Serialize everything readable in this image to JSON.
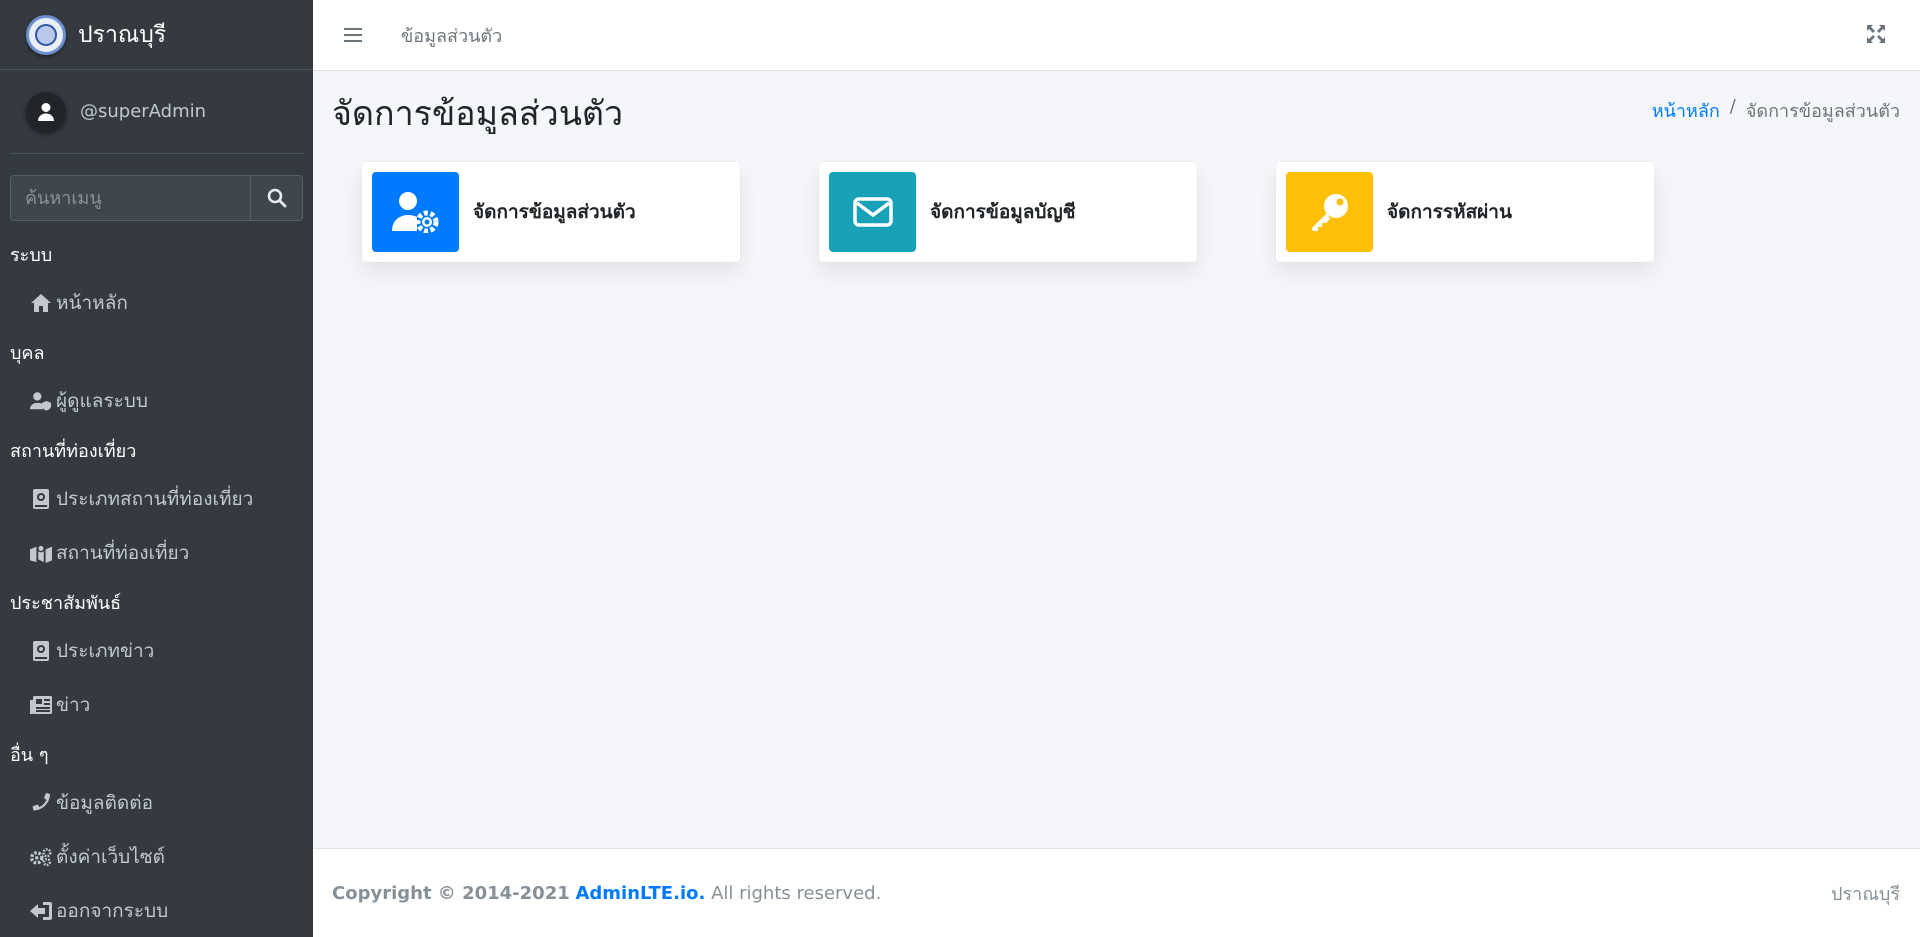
{
  "brand": {
    "name": "ปราณบุรี"
  },
  "user": {
    "name": "@superAdmin"
  },
  "sidebar": {
    "search_placeholder": "ค้นหาเมนู",
    "sections": [
      {
        "header": "ระบบ",
        "items": [
          {
            "label": "หน้าหลัก",
            "icon": "home-icon"
          }
        ]
      },
      {
        "header": "บุคล",
        "items": [
          {
            "label": "ผู้ดูแลระบบ",
            "icon": "user-shield-icon"
          }
        ]
      },
      {
        "header": "สถานที่ท่องเที่ยว",
        "items": [
          {
            "label": "ประเภทสถานที่ท่องเที่ยว",
            "icon": "atlas-book-icon"
          },
          {
            "label": "สถานที่ท่องเที่ยว",
            "icon": "map-marked-icon"
          }
        ]
      },
      {
        "header": "ประชาสัมพันธ์",
        "items": [
          {
            "label": "ประเภทข่าว",
            "icon": "atlas-book-icon"
          },
          {
            "label": "ข่าว",
            "icon": "newspaper-icon"
          }
        ]
      },
      {
        "header": "อื่น ๆ",
        "items": [
          {
            "label": "ข้อมูลติดต่อ",
            "icon": "phone-icon"
          },
          {
            "label": "ตั้งค่าเว็บไซต์",
            "icon": "cogs-icon"
          },
          {
            "label": "ออกจากระบบ",
            "icon": "sign-out-icon"
          }
        ]
      }
    ]
  },
  "topbar": {
    "link": "ข้อมูลส่วนตัว"
  },
  "content": {
    "title": "จัดการข้อมูลส่วนตัว",
    "breadcrumb": {
      "home": "หน้าหลัก",
      "separator": "/",
      "current": "จัดการข้อมูลส่วนตัว"
    },
    "cards": [
      {
        "label": "จัดการข้อมูลส่วนตัว",
        "icon": "user-cog-icon",
        "color": "#007bff"
      },
      {
        "label": "จัดการข้อมูลบัญชี",
        "icon": "envelope-icon",
        "color": "#17a2b8"
      },
      {
        "label": "จัดการรหัสผ่าน",
        "icon": "key-icon",
        "color": "#ffc107"
      }
    ]
  },
  "footer": {
    "copyright": "Copyright © 2014-2021",
    "link": "AdminLTE.io.",
    "rights": "All rights reserved.",
    "right_text": "ปราณบุรี"
  }
}
